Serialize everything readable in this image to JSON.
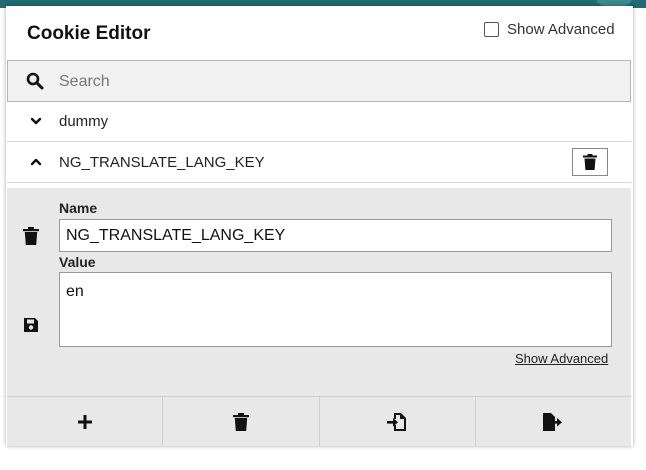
{
  "header": {
    "title": "Cookie Editor",
    "show_advanced_label": "Show Advanced",
    "show_advanced_checked": false
  },
  "search": {
    "placeholder": "Search"
  },
  "cookies": [
    {
      "name": "dummy",
      "expanded": false
    },
    {
      "name": "NG_TRANSLATE_LANG_KEY",
      "expanded": true
    }
  ],
  "editor": {
    "name_label": "Name",
    "name_value": "NG_TRANSLATE_LANG_KEY",
    "value_label": "Value",
    "value_value": "en",
    "show_advanced_link": "Show Advanced"
  },
  "footer": {
    "buttons": [
      "add-icon",
      "trash-icon",
      "import-icon",
      "export-icon"
    ]
  },
  "colors": {
    "top_strip": "#1f6b72",
    "panel_bg": "#e8e8e8",
    "search_bg": "#f1f1f1"
  }
}
